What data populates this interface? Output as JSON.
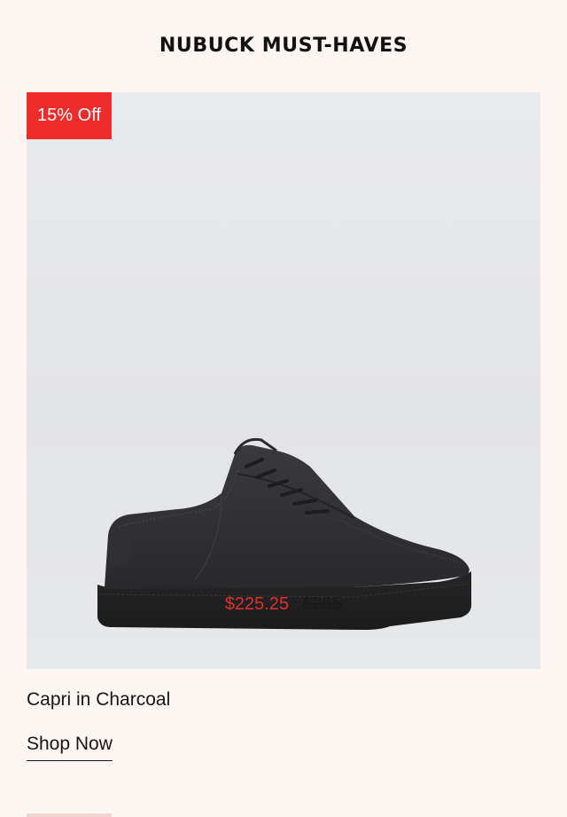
{
  "section": {
    "title": "NUBUCK MUST-HAVES"
  },
  "product": {
    "badge": "15% Off",
    "price_sale": "$225.25",
    "price_original": "$265",
    "name": "Capri in Charcoal",
    "cta_label": "Shop Now",
    "image_icon": "sneaker-image"
  },
  "colors": {
    "background": "#fdf5f1",
    "badge": "#ee2c2c",
    "sale_price": "#e0312b",
    "card": "#e6e7e9"
  }
}
